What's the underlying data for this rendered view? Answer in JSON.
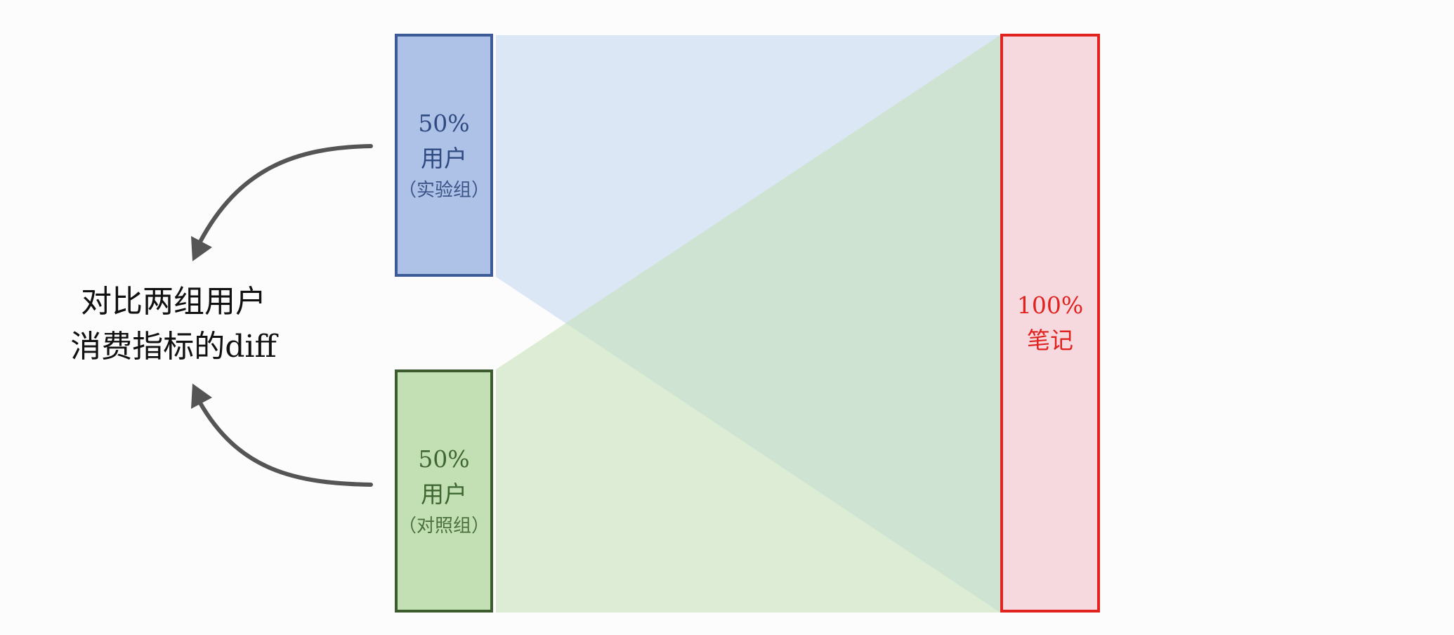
{
  "left_label": {
    "line1": "对比两组用户",
    "line2": "消费指标的diff"
  },
  "experiment_group": {
    "percent": "50%",
    "label": "用户",
    "group": "（实验组）"
  },
  "control_group": {
    "percent": "50%",
    "label": "用户",
    "group": "（对照组）"
  },
  "notes": {
    "percent": "100%",
    "label": "笔记"
  },
  "colors": {
    "experiment_fill": "#aec1e6",
    "experiment_border": "#3c5a96",
    "control_fill": "#c3e0b4",
    "control_border": "#3d5c2e",
    "notes_fill": "#f5d9de",
    "notes_border": "#e0231f",
    "arrow": "#555555"
  }
}
